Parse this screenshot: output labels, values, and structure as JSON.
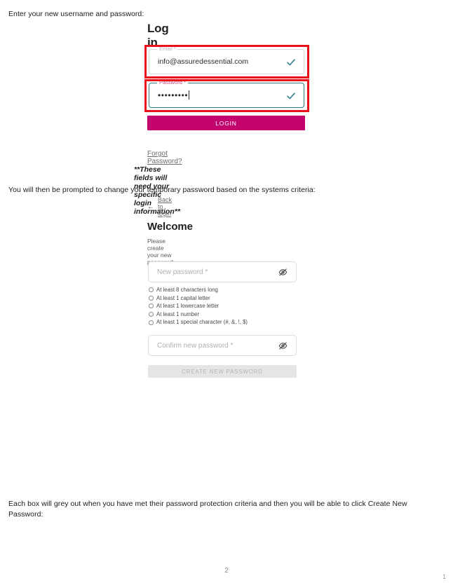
{
  "document": {
    "intro_line": "Enter your new username and password:",
    "middle_line": "You will then be prompted to change your temporary password based on the systems criteria:",
    "bottom_line": "Each box will grey out when you have met their password protection criteria and then you will be able to click Create New Password:",
    "page_number": "2",
    "corner_number": "1"
  },
  "login_screen": {
    "title": "Log in",
    "email": {
      "label": "Email *",
      "value": "info@assuredessential.com",
      "valid_icon": "check-icon"
    },
    "password": {
      "label": "Password *",
      "value": "•••••••••",
      "valid_icon": "check-icon"
    },
    "login_button": "LOGIN",
    "forgot_password_link": "Forgot Password?",
    "note": "**These fields will need your specific login information**",
    "back_to_login": "Back to login",
    "back_arrow_icon": "arrow-left-icon"
  },
  "welcome_screen": {
    "title": "Welcome",
    "subtitle": "Please create your new password:",
    "new_password_placeholder": "New password *",
    "confirm_password_placeholder": "Confirm new password *",
    "toggle_icon": "eye-off-icon",
    "criteria": [
      "At least 8 characters long",
      "At least 1 capital letter",
      "At least 1 lowercase letter",
      "At least 1 number",
      "At least 1 special character (#, &, !, $)"
    ],
    "create_button": "CREATE NEW PASSWORD"
  },
  "colors": {
    "brand_magenta": "#c3046e",
    "annotation_red": "#e8131a",
    "valid_teal": "#2e7d86",
    "focus_border": "#2e7d86",
    "disabled_button": "#e5e5e5"
  }
}
